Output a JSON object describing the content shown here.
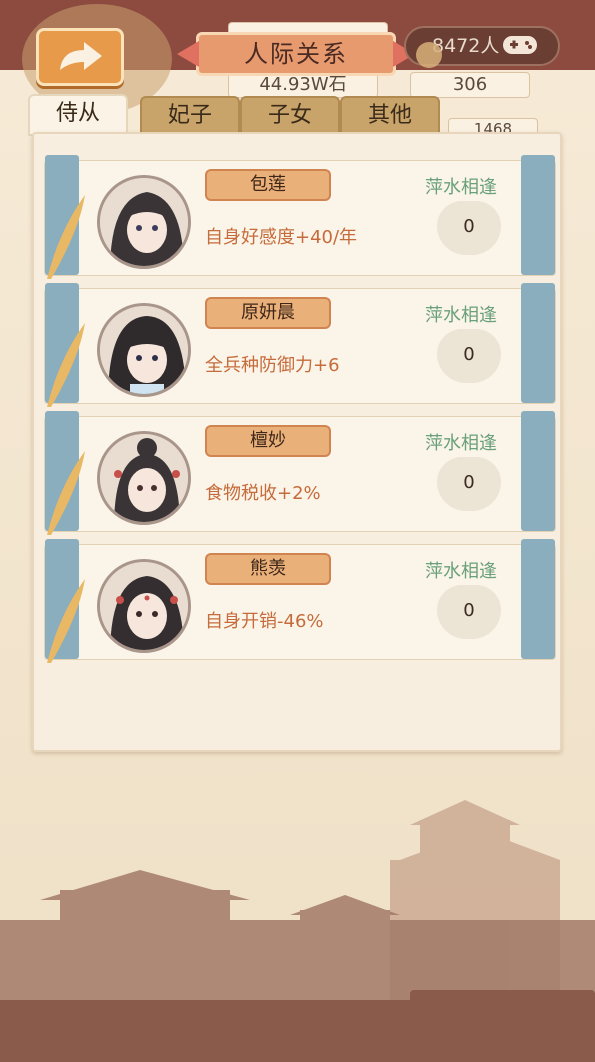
{
  "header": {
    "title": "人际关系",
    "population": "8472人",
    "stat_partial": "",
    "grain": "44.93W石",
    "count_a": "306",
    "count_b": "1468"
  },
  "tabs": [
    {
      "label": "侍从",
      "active": true
    },
    {
      "label": "妃子",
      "active": false
    },
    {
      "label": "子女",
      "active": false
    },
    {
      "label": "其他",
      "active": false
    }
  ],
  "cards": [
    {
      "name": "包莲",
      "effect": "自身好感度+40/年",
      "status": "萍水相逢",
      "affinity": "0"
    },
    {
      "name": "原妍晨",
      "effect": "全兵种防御力+6",
      "status": "萍水相逢",
      "affinity": "0"
    },
    {
      "name": "檀妙",
      "effect": "食物税收+2%",
      "status": "萍水相逢",
      "affinity": "0"
    },
    {
      "name": "熊羡",
      "effect": "自身开销-46%",
      "status": "萍水相逢",
      "affinity": "0"
    }
  ],
  "icons": {
    "back": "back-arrow-icon",
    "gamepad": "gamepad-icon",
    "feather": "feather-icon"
  },
  "colors": {
    "band": "#8c4b3e",
    "accent": "#e79a4a",
    "status_green": "#6aa07a",
    "effect_orange": "#c66b3b"
  }
}
